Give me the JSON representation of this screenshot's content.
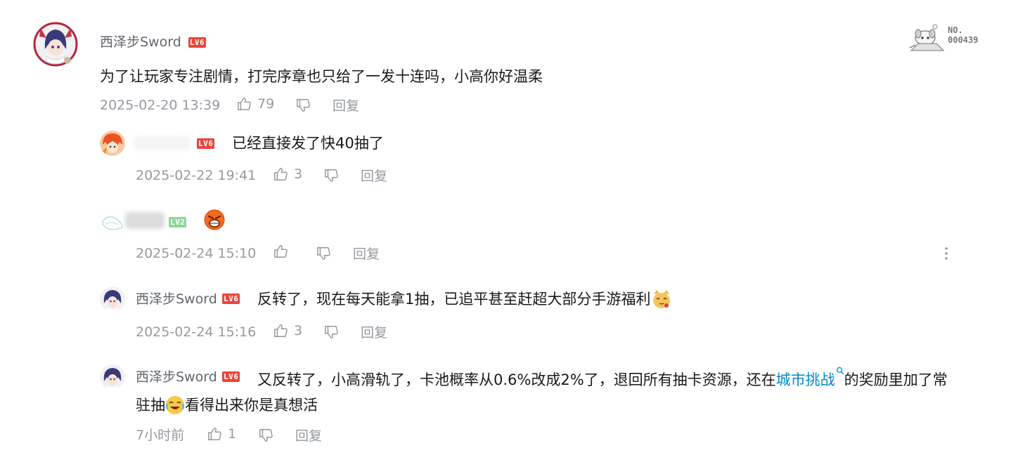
{
  "comment": {
    "username": "西泽步Sword",
    "level": "LV6",
    "text": "为了让玩家专注剧情，打完序章也只给了一发十连吗，小高你好温柔",
    "time": "2025-02-20 13:39",
    "likes": "79",
    "reply_label": "回复",
    "badge": {
      "label": "NO.",
      "number": "000439"
    }
  },
  "replies": [
    {
      "username": "",
      "level": "LV6",
      "text": "已经直接发了快40抽了",
      "time": "2025-02-22 19:41",
      "likes": "3",
      "reply_label": "回复"
    },
    {
      "username": "",
      "level": "LV2",
      "text": "",
      "time": "2025-02-24 15:10",
      "likes": "",
      "reply_label": "回复"
    },
    {
      "username": "西泽步Sword",
      "level": "LV6",
      "text": "反转了，现在每天能拿1抽，已追平甚至赶超大部分手游福利",
      "time": "2025-02-24 15:16",
      "likes": "3",
      "reply_label": "回复"
    },
    {
      "username": "西泽步Sword",
      "level": "LV6",
      "text_before_link": "又反转了，小高滑轨了，卡池概率从0.6%改成2%了，退回所有抽卡资源，还在",
      "link_text": "城市挑战",
      "text_after_link": "的奖励里加了常",
      "text_line2": "看得出来你是真想活",
      "text_line2_prefix": "驻抽",
      "time": "7小时前",
      "likes": "1",
      "reply_label": "回复"
    }
  ],
  "colors": {
    "meta": "#9499a0",
    "link": "#008ac5",
    "level6": "#e8453c",
    "level2": "#8fd49a"
  }
}
